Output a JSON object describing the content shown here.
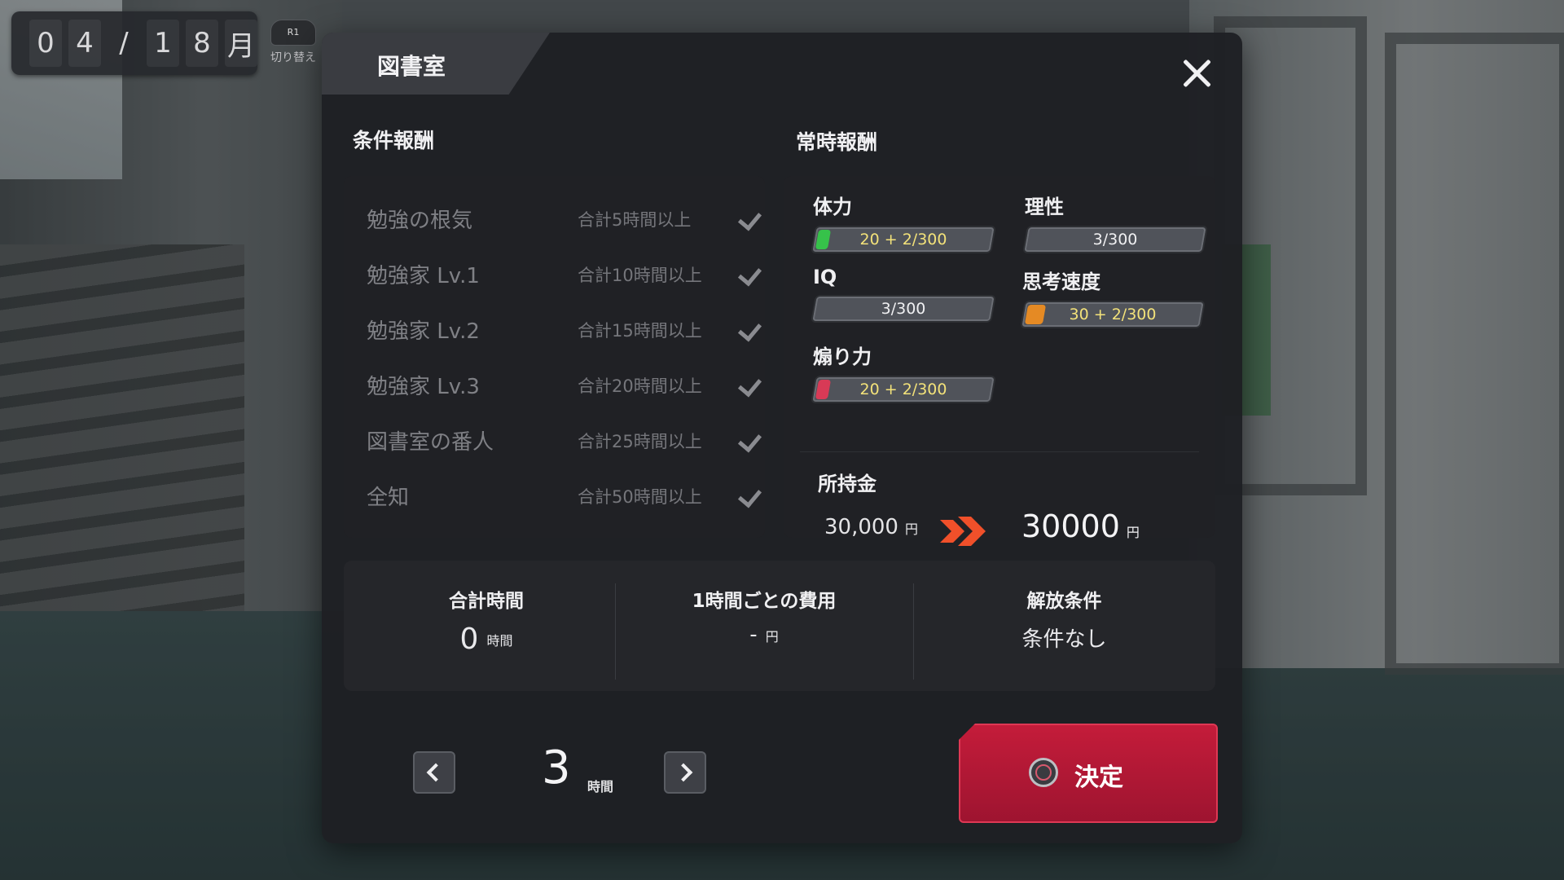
{
  "date": {
    "digits": [
      "0",
      "4",
      "/",
      "1",
      "8",
      "月"
    ],
    "switch_button": "R1",
    "switch_label": "切り替え"
  },
  "panel": {
    "title": "図書室"
  },
  "conditional_rewards": {
    "title": "条件報酬",
    "items": [
      {
        "name": "勉強の根気",
        "requirement": "合計5時間以上"
      },
      {
        "name": "勉強家 Lv.1",
        "requirement": "合計10時間以上"
      },
      {
        "name": "勉強家 Lv.2",
        "requirement": "合計15時間以上"
      },
      {
        "name": "勉強家 Lv.3",
        "requirement": "合計20時間以上"
      },
      {
        "name": "図書室の番人",
        "requirement": "合計25時間以上"
      },
      {
        "name": "全知",
        "requirement": "合計50時間以上"
      }
    ]
  },
  "constant_rewards": {
    "title": "常時報酬",
    "stats": [
      {
        "name": "体力",
        "value": "20 + 2/300",
        "fill_fraction": 0.07,
        "color": "#36c24a",
        "text_color": "#f3e27a"
      },
      {
        "name": "理性",
        "value": "3/300",
        "fill_fraction": 0.01,
        "color": "#50535a",
        "text_color": "#f0f0f2"
      },
      {
        "name": "IQ",
        "value": "3/300",
        "fill_fraction": 0.01,
        "color": "#50535a",
        "text_color": "#f0f0f2"
      },
      {
        "name": "思考速度",
        "value": "30 + 2/300",
        "fill_fraction": 0.1,
        "color": "#e58a24",
        "text_color": "#f3e27a"
      },
      {
        "name": "煽り力",
        "value": "20 + 2/300",
        "fill_fraction": 0.07,
        "color": "#d83a56",
        "text_color": "#f3e27a"
      }
    ],
    "money": {
      "label": "所持金",
      "current": "30,000",
      "after": "30000",
      "unit": "円",
      "arrow_color": "#f0502a"
    }
  },
  "info": {
    "total_time": {
      "label": "合計時間",
      "value": "0",
      "unit": "時間"
    },
    "cost_per_hour": {
      "label": "1時間ごとの費用",
      "value": "-",
      "unit": "円"
    },
    "unlock": {
      "label": "解放条件",
      "value": "条件なし"
    }
  },
  "hours_selector": {
    "value": "3",
    "unit": "時間"
  },
  "confirm_button": {
    "label": "決定"
  }
}
